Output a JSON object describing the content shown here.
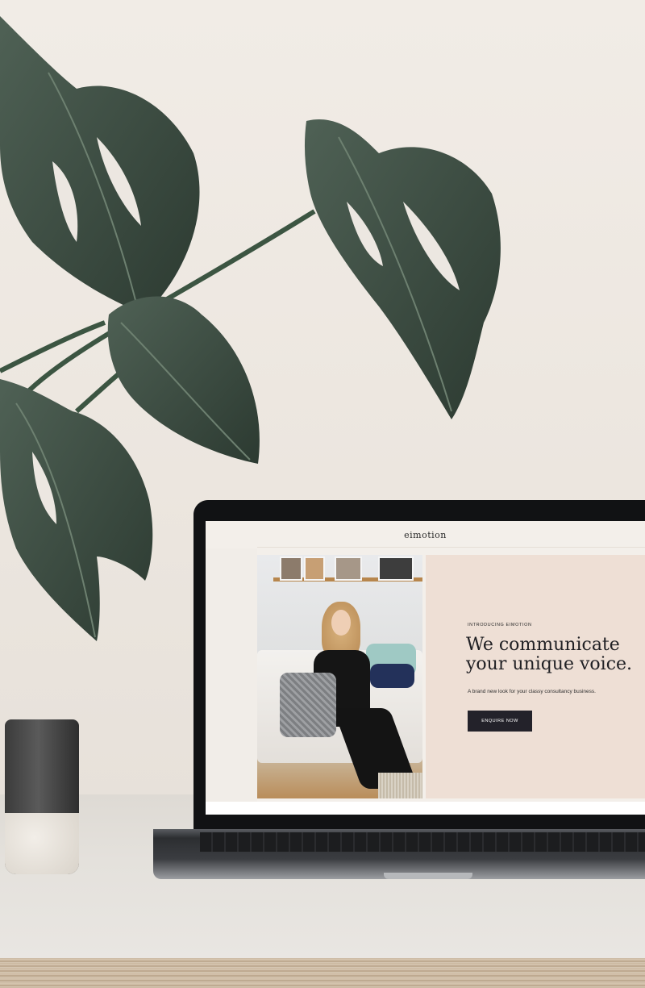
{
  "website": {
    "logo": "eimotion",
    "eyebrow": "INTRODUCING EIMOTION",
    "headline": "We communicate your unique voice.",
    "subheadline": "A brand new look for your classy consultancy business.",
    "cta_label": "ENQUIRE NOW"
  },
  "colors": {
    "wall": "#ece7e1",
    "leaf": "#3b4a3f",
    "hero_panel": "#eedfd5",
    "cta_background": "#23222a",
    "laptop_bezel": "#111214"
  },
  "icons": {
    "plant": "monstera-plant-icon",
    "cup": "ceramic-cup-icon",
    "laptop": "laptop-icon"
  }
}
